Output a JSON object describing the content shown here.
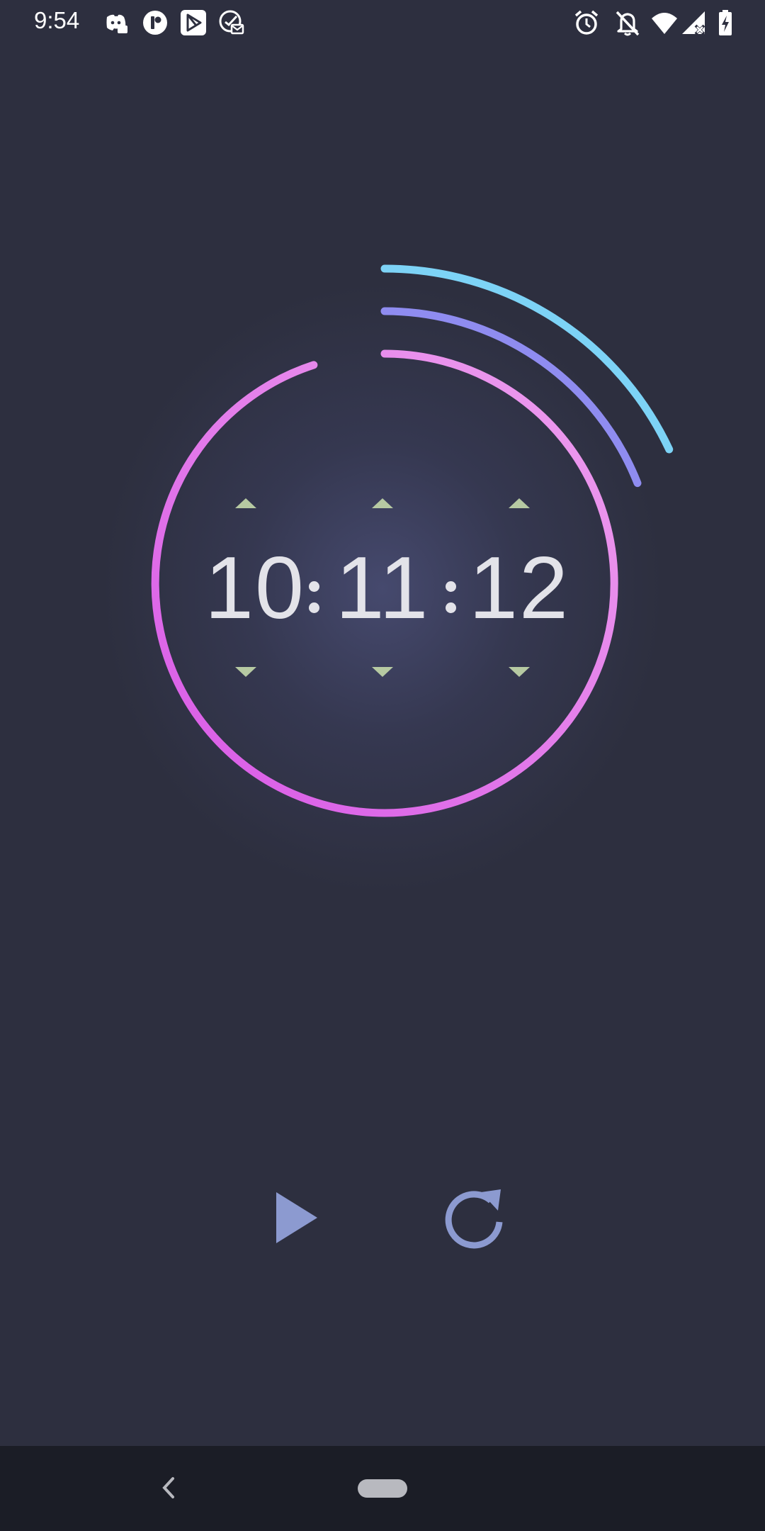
{
  "status_bar": {
    "time": "9:54",
    "left_icons": [
      "discord-icon",
      "ticktick-icon",
      "play-store-icon",
      "email-check-icon"
    ],
    "right_icons": [
      "alarm-icon",
      "notifications-off-icon",
      "wifi-icon",
      "signal-off-icon",
      "battery-charging-icon"
    ]
  },
  "timer": {
    "hours": "10",
    "minutes": "11",
    "seconds": "12",
    "progress": {
      "hours_fraction": 0.18,
      "minutes_fraction": 0.19,
      "seconds_fraction": 0.95
    },
    "colors": {
      "hours_ring": "#7dd3f6",
      "minutes_ring": "#8f8cf0",
      "seconds_ring_start": "#e895ec",
      "seconds_ring_end": "#dd5ae8",
      "digits": "#e3e3e9",
      "adjust_arrows": "#b6c9a2"
    }
  },
  "controls": {
    "play": "play-icon",
    "reset": "reset-icon",
    "color": "#8c9ad0"
  },
  "nav_bar": {
    "back": "back-chevron-icon",
    "home": "home-pill"
  },
  "colors": {
    "background": "#2d2f3f",
    "nav_background": "#1b1d26"
  }
}
